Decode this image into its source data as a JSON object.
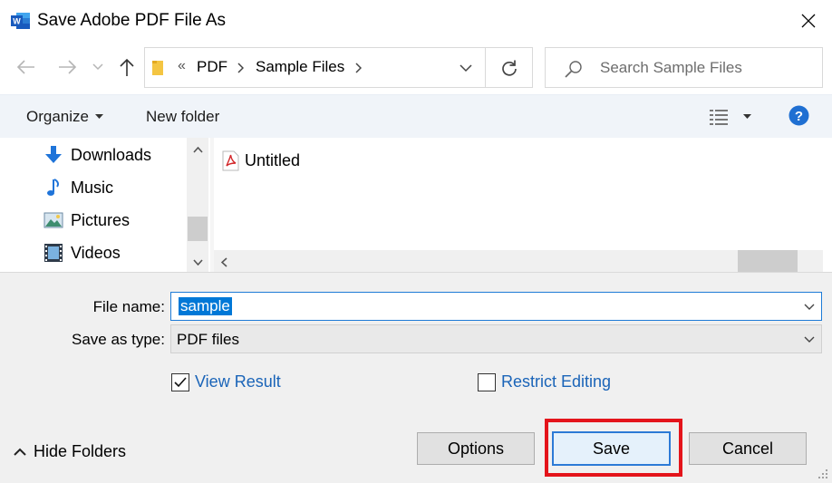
{
  "window": {
    "title": "Save Adobe PDF File As",
    "app_icon": "word-icon",
    "close_icon": "close-icon"
  },
  "address": {
    "overflow": "«",
    "crumbs": [
      "PDF",
      "Sample Files"
    ],
    "search_placeholder": "Search Sample Files"
  },
  "toolbar": {
    "organize_label": "Organize",
    "new_folder_label": "New folder"
  },
  "sidebar": {
    "items": [
      {
        "label": "Downloads",
        "icon": "download-icon"
      },
      {
        "label": "Music",
        "icon": "music-icon"
      },
      {
        "label": "Pictures",
        "icon": "pictures-icon"
      },
      {
        "label": "Videos",
        "icon": "videos-icon"
      }
    ]
  },
  "files": [
    {
      "name": "Untitled",
      "icon": "pdf-icon"
    }
  ],
  "form": {
    "file_name_label": "File name:",
    "file_name_value": "sample",
    "save_type_label": "Save as type:",
    "save_type_value": "PDF files",
    "view_result_label": "View Result",
    "view_result_checked": true,
    "restrict_editing_label": "Restrict Editing",
    "restrict_editing_checked": false
  },
  "footer": {
    "hide_folders_label": "Hide Folders",
    "options_label": "Options",
    "save_label": "Save",
    "cancel_label": "Cancel"
  },
  "colors": {
    "accent": "#1e7bd7",
    "highlight": "#e4141b",
    "link": "#1a64b8"
  }
}
